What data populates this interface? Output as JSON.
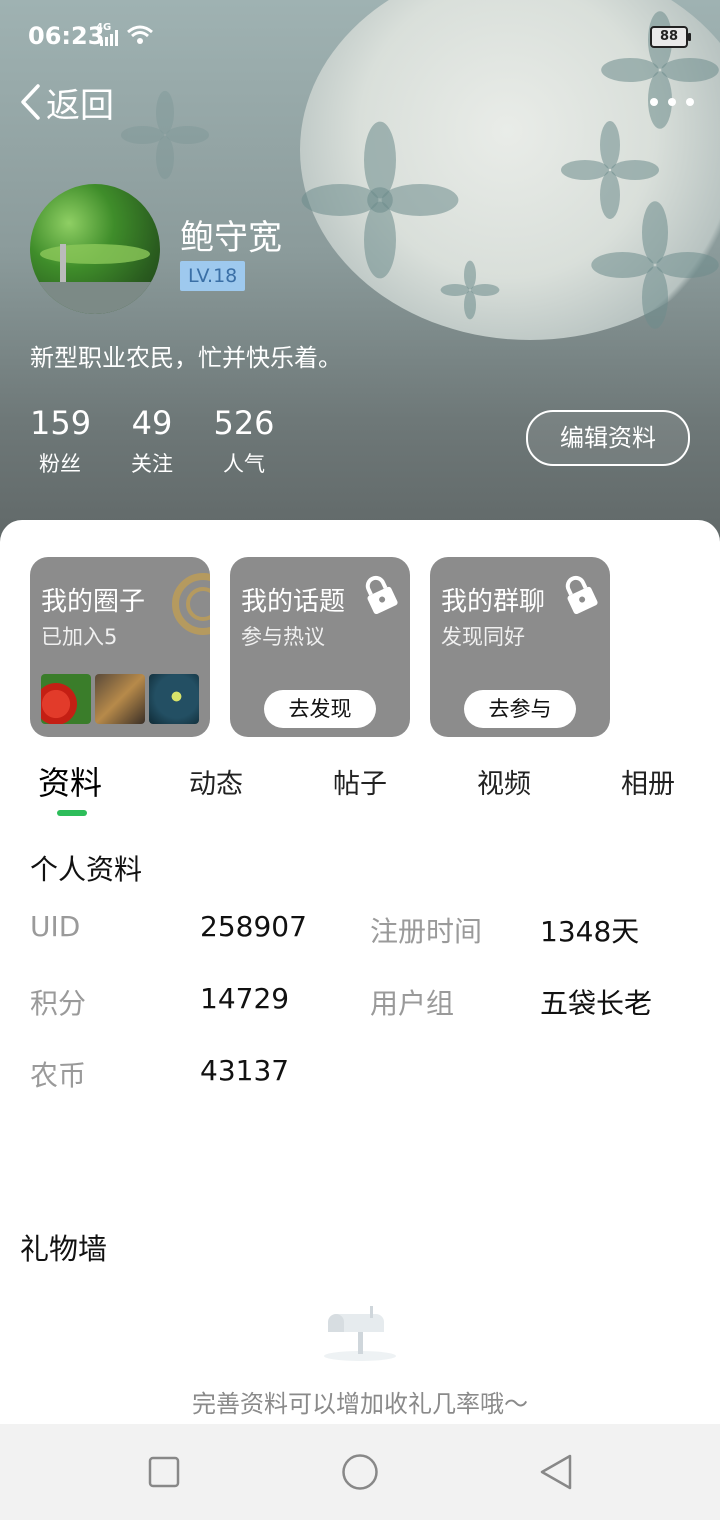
{
  "status_bar": {
    "time": "06:23",
    "network": "4G",
    "battery": "88"
  },
  "nav": {
    "back_label": "返回"
  },
  "profile": {
    "name": "鲍守宽",
    "level": "LV.18",
    "bio": "新型职业农民，忙并快乐着。",
    "stats": [
      {
        "value": "159",
        "label": "粉丝"
      },
      {
        "value": "49",
        "label": "关注"
      },
      {
        "value": "526",
        "label": "人气"
      }
    ],
    "edit_button": "编辑资料"
  },
  "cards": [
    {
      "title": "我的圈子",
      "subtitle": "已加入5"
    },
    {
      "title": "我的话题",
      "subtitle": "参与热议",
      "button": "去发现"
    },
    {
      "title": "我的群聊",
      "subtitle": "发现同好",
      "button": "去参与"
    }
  ],
  "tabs": [
    "资料",
    "动态",
    "帖子",
    "视频",
    "相册"
  ],
  "active_tab": "资料",
  "info": {
    "title": "个人资料",
    "fields": [
      {
        "label": "UID",
        "value": "258907"
      },
      {
        "label": "注册时间",
        "value": "1348天"
      },
      {
        "label": "积分",
        "value": "14729"
      },
      {
        "label": "用户组",
        "value": "五袋长老"
      },
      {
        "label": "农币",
        "value": "43137"
      }
    ]
  },
  "gift_wall": {
    "title": "礼物墙",
    "message": "完善资料可以增加收礼几率哦～"
  },
  "colors": {
    "accent_green": "#2dbd5a",
    "card_gray": "#8c8c8c",
    "level_bg": "#9ec9ee"
  }
}
